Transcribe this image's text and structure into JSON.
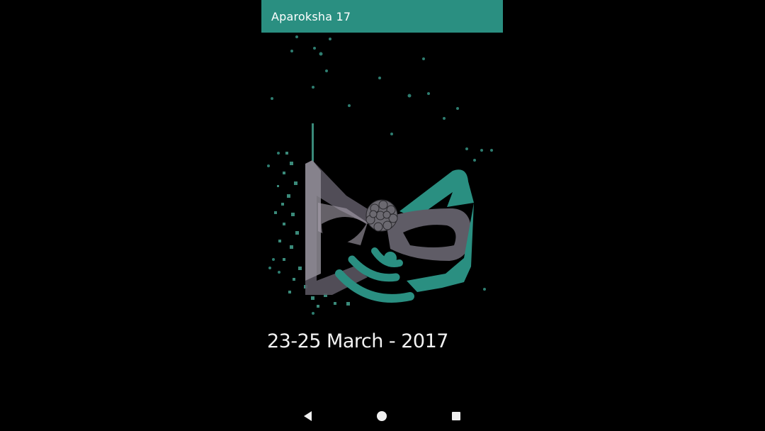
{
  "app": {
    "title": "Aparoksha 17",
    "accent_color": "#2a8f81"
  },
  "splash": {
    "logo": "aparoksha-mask-logo",
    "date": "23-25 March - 2017"
  },
  "nav_bar": {
    "back_icon": "back-triangle-icon",
    "home_icon": "home-circle-icon",
    "recents_icon": "recents-square-icon"
  }
}
